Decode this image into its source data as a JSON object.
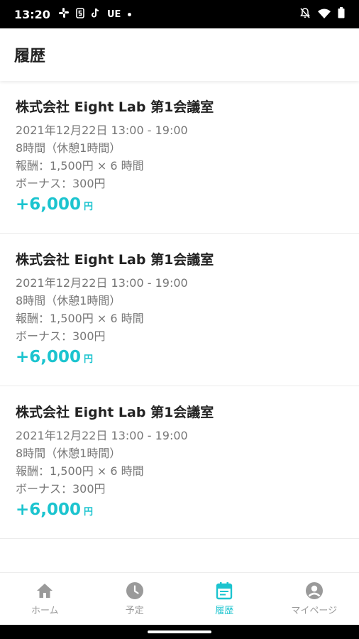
{
  "status_bar": {
    "time": "13:20",
    "left_icons": [
      "slack-icon",
      "s-icon",
      "tiktok-icon",
      "ue-icon",
      "dot-icon"
    ],
    "ue_label": "UE",
    "right_icons": [
      "muted-bell-icon",
      "wifi-icon",
      "battery-icon"
    ]
  },
  "header": {
    "title": "履歴"
  },
  "history": [
    {
      "title": "株式会社 Eight Lab 第1会議室",
      "datetime": "2021年12月22日 13:00 - 19:00",
      "duration": "8時間（休憩1時間）",
      "reward": "報酬：1,500円 × 6 時間",
      "bonus": "ボーナス：300円",
      "amount": "+6,000",
      "unit": "円"
    },
    {
      "title": "株式会社 Eight Lab 第1会議室",
      "datetime": "2021年12月22日 13:00 - 19:00",
      "duration": "8時間（休憩1時間）",
      "reward": "報酬：1,500円 × 6 時間",
      "bonus": "ボーナス：300円",
      "amount": "+6,000",
      "unit": "円"
    },
    {
      "title": "株式会社 Eight Lab 第1会議室",
      "datetime": "2021年12月22日 13:00 - 19:00",
      "duration": "8時間（休憩1時間）",
      "reward": "報酬：1,500円 × 6 時間",
      "bonus": "ボーナス：300円",
      "amount": "+6,000",
      "unit": "円"
    }
  ],
  "bottom_nav": [
    {
      "label": "ホーム",
      "icon": "home-icon",
      "active": false
    },
    {
      "label": "予定",
      "icon": "clock-icon",
      "active": false
    },
    {
      "label": "履歴",
      "icon": "calendar-icon",
      "active": true
    },
    {
      "label": "マイページ",
      "icon": "account-icon",
      "active": false
    }
  ],
  "colors": {
    "accent": "#1cc4cf",
    "inactive": "#9a9a9a",
    "text": "#222222",
    "subtext": "#777777"
  }
}
